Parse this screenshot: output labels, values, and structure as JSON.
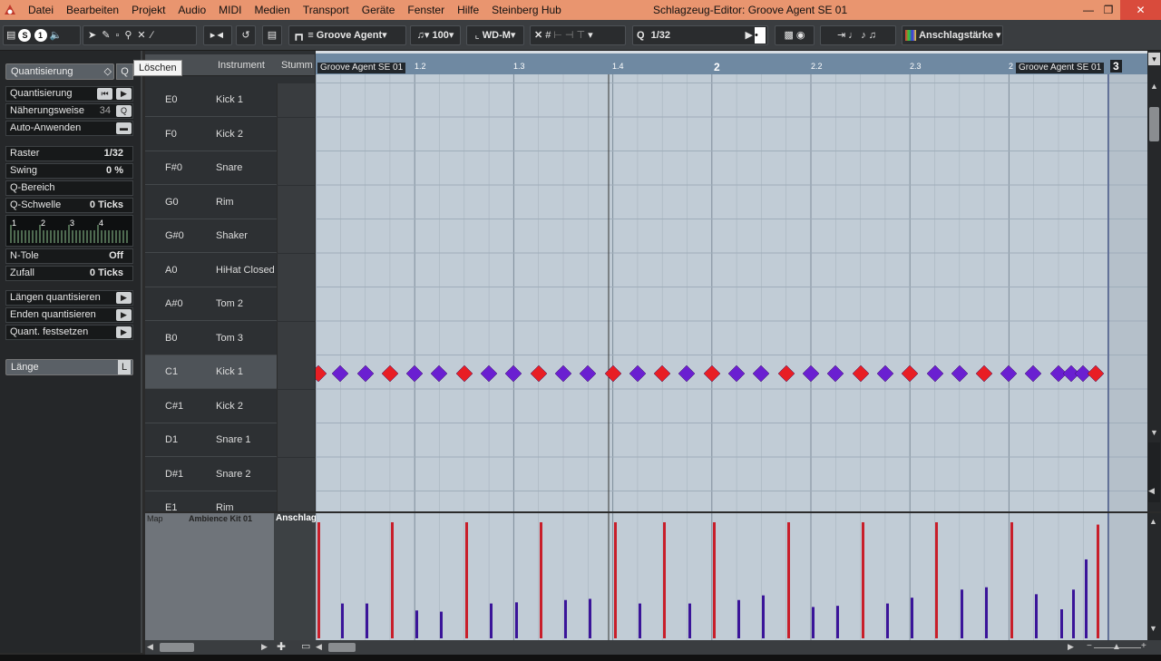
{
  "app": {
    "window_title": "Schlagzeug-Editor: Groove Agent SE 01"
  },
  "menu": [
    "Datei",
    "Bearbeiten",
    "Projekt",
    "Audio",
    "MIDI",
    "Medien",
    "Transport",
    "Geräte",
    "Fenster",
    "Hilfe",
    "Steinberg Hub"
  ],
  "toolbar": {
    "instrument_select": "Groove Agent",
    "velocity_value": "100",
    "length_select": "WD-M",
    "quantize_value": "1/32",
    "velocity_lane_select": "Anschlagstärke"
  },
  "left_panel": {
    "quantize_section": "Quantisierung",
    "tooltip": "Löschen",
    "rows": [
      {
        "label": "Quantisierung",
        "value": ""
      },
      {
        "label": "Näherungsweise",
        "value": "34"
      },
      {
        "label": "Auto-Anwenden",
        "value": ""
      },
      {
        "label": "Raster",
        "value": "1/32"
      },
      {
        "label": "Swing",
        "value": "0 %"
      },
      {
        "label": "Q-Bereich",
        "value": ""
      },
      {
        "label": "Q-Schwelle",
        "value": "0 Ticks"
      },
      {
        "label": "N-Tole",
        "value": "Off"
      },
      {
        "label": "Zufall",
        "value": "0 Ticks"
      },
      {
        "label": "Längen quantisieren",
        "value": ""
      },
      {
        "label": "Enden quantisieren",
        "value": ""
      },
      {
        "label": "Quant. festsetzen",
        "value": ""
      }
    ],
    "grid_numbers": [
      "1",
      "2",
      "3",
      "4"
    ],
    "length_section": "Länge"
  },
  "drum_list": {
    "headers": {
      "pitch": "höhe",
      "instrument": "Instrument",
      "mute": "Stumm"
    },
    "rows": [
      {
        "pitch": "E0",
        "name": "Kick 1"
      },
      {
        "pitch": "F0",
        "name": "Kick 2"
      },
      {
        "pitch": "F#0",
        "name": "Snare"
      },
      {
        "pitch": "G0",
        "name": "Rim"
      },
      {
        "pitch": "G#0",
        "name": "Shaker"
      },
      {
        "pitch": "A0",
        "name": "HiHat Closed"
      },
      {
        "pitch": "A#0",
        "name": "Tom 2"
      },
      {
        "pitch": "B0",
        "name": "Tom 3"
      },
      {
        "pitch": "C1",
        "name": "Kick 1"
      },
      {
        "pitch": "C#1",
        "name": "Kick 2"
      },
      {
        "pitch": "D1",
        "name": "Snare 1"
      },
      {
        "pitch": "D#1",
        "name": "Snare 2"
      },
      {
        "pitch": "E1",
        "name": "Rim"
      }
    ],
    "selected_index": 8
  },
  "ruler": {
    "part_name": "Groove Agent SE 01",
    "labels": [
      "1.2",
      "1.3",
      "1.4",
      "2",
      "2.2",
      "2.3",
      "2",
      "3"
    ]
  },
  "lower": {
    "map_label": "Map",
    "map_value": "Ambience Kit 01",
    "lane_label": "Anschlags"
  },
  "colors": {
    "accent_note": "#e81e24",
    "normal_note": "#6a1fd1",
    "grid_bg": "#c1ccd6",
    "title_bar": "#e9956f"
  }
}
